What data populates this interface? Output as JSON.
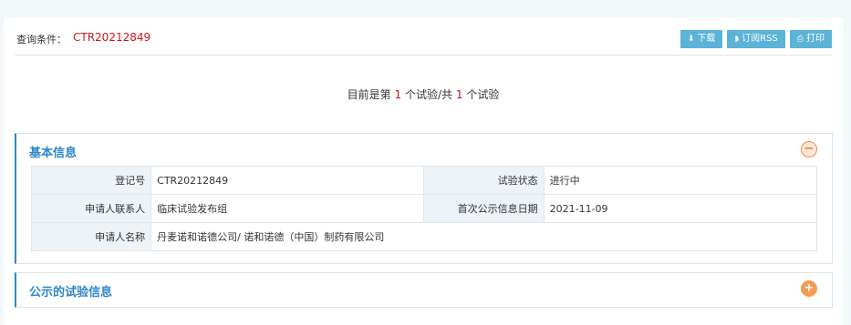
{
  "query": {
    "label": "查询条件：",
    "value": "CTR20212849"
  },
  "toolbar": {
    "download_label": "下载",
    "rss_label": "订阅RSS",
    "print_label": "打印"
  },
  "summary": {
    "prefix": "目前是第",
    "current": "1",
    "middle": "个试验/共",
    "total": "1",
    "suffix": "个试验"
  },
  "basic_panel": {
    "title": "基本信息",
    "toggle": "−",
    "rows": [
      {
        "label1": "登记号",
        "value1": "CTR20212849",
        "label2": "试验状态",
        "value2": "进行中"
      },
      {
        "label1": "申请人联系人",
        "value1": "临床试验发布组",
        "label2": "首次公示信息日期",
        "value2": "2021-11-09"
      }
    ],
    "applicant_label": "申请人名称",
    "applicant_value": "丹麦诺和诺德公司/ 诺和诺德（中国）制药有限公司"
  },
  "trial_panel": {
    "title": "公示的试验信息",
    "toggle": "+"
  },
  "colors": {
    "accent": "#2e86c8",
    "red": "#c8161d",
    "button": "#5bb3d8",
    "toggle": "#f08a4b"
  }
}
